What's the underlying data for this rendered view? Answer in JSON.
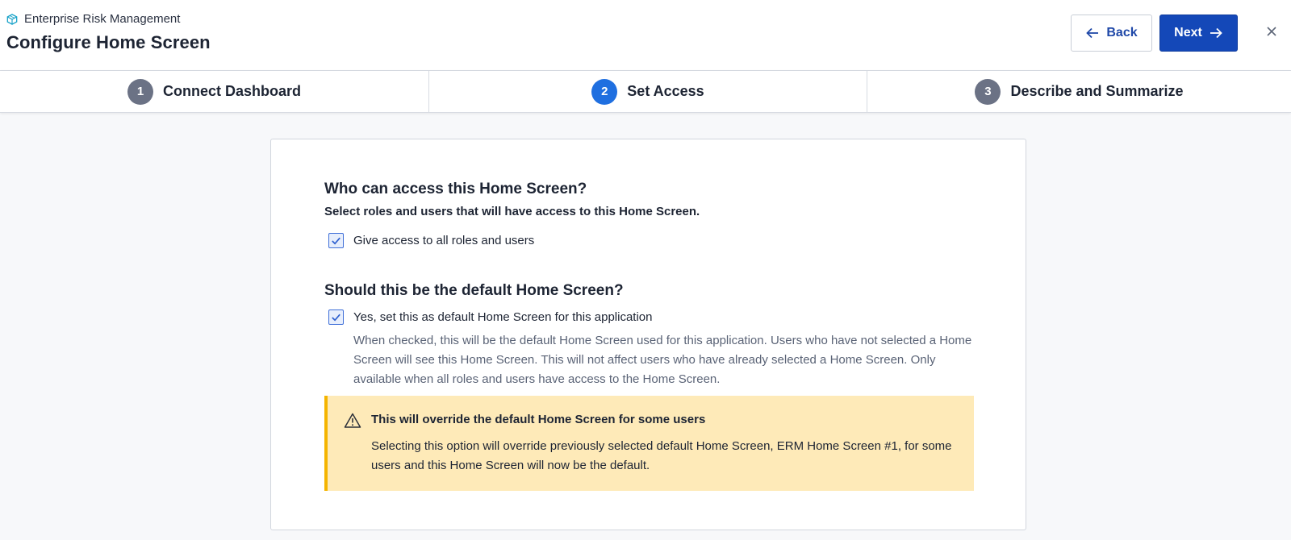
{
  "header": {
    "app_name": "Enterprise Risk Management",
    "app_icon": "cube-icon",
    "title": "Configure Home Screen",
    "back_label": "Back",
    "next_label": "Next",
    "close_glyph": "×"
  },
  "stepper": {
    "steps": [
      {
        "number": "1",
        "label": "Connect Dashboard",
        "active": false
      },
      {
        "number": "2",
        "label": "Set Access",
        "active": true
      },
      {
        "number": "3",
        "label": "Describe and Summarize",
        "active": false
      }
    ]
  },
  "access": {
    "title": "Who can access this Home Screen?",
    "subtitle": "Select roles and users that will have access to this Home Screen.",
    "checkbox_label": "Give access to all roles and users",
    "checked": true
  },
  "default_screen": {
    "title": "Should this be the default Home Screen?",
    "checkbox_label": "Yes, set this as default Home Screen for this application",
    "checked": true,
    "help": "When checked, this will be the default Home Screen used for this application. Users who have not selected a Home Screen will see this Home Screen. This will not affect users who have already selected a Home Screen. Only available when all roles and users have access to the Home Screen."
  },
  "warning": {
    "title": "This will override the default Home Screen for some users",
    "body": "Selecting this option will override previously selected default Home Screen, ERM Home Screen #1, for some users and this Home Screen will now be the default."
  },
  "colors": {
    "primary": "#1448b8",
    "active_step": "#1f6fe0",
    "warning_bg": "#feeab8",
    "warning_accent": "#f4b400"
  }
}
